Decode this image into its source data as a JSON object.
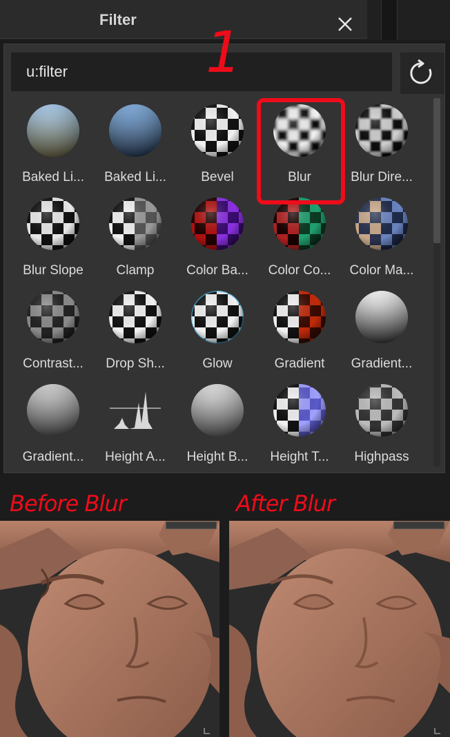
{
  "window": {
    "title": "Filter"
  },
  "search": {
    "value": "u:filter"
  },
  "annotation": {
    "step_number": "1",
    "before_caption": "Before Blur",
    "after_caption": "After Blur"
  },
  "filters": [
    {
      "label": "Baked Li...",
      "thumb": "sky-sphere-icon"
    },
    {
      "label": "Baked Li...",
      "thumb": "sky-blue-sphere-icon"
    },
    {
      "label": "Bevel",
      "thumb": "checker-sphere-icon"
    },
    {
      "label": "Blur",
      "thumb": "blurred-checker-sphere-icon"
    },
    {
      "label": "Blur Dire...",
      "thumb": "directional-blur-sphere-icon"
    },
    {
      "label": "Blur Slope",
      "thumb": "slope-sphere-icon"
    },
    {
      "label": "Clamp",
      "thumb": "clamp-sphere-icon"
    },
    {
      "label": "Color Ba...",
      "thumb": "color-balance-sphere-icon"
    },
    {
      "label": "Color Co...",
      "thumb": "color-correct-sphere-icon"
    },
    {
      "label": "Color Ma...",
      "thumb": "color-match-sphere-icon"
    },
    {
      "label": "Contrast...",
      "thumb": "contrast-sphere-icon"
    },
    {
      "label": "Drop Sh...",
      "thumb": "drop-shadow-sphere-icon"
    },
    {
      "label": "Glow",
      "thumb": "glow-sphere-icon"
    },
    {
      "label": "Gradient",
      "thumb": "gradient-sphere-icon"
    },
    {
      "label": "Gradient...",
      "thumb": "gradient-bw-sphere-icon"
    },
    {
      "label": "Gradient...",
      "thumb": "gradient-stripes-sphere-icon"
    },
    {
      "label": "Height A...",
      "thumb": "height-graph-icon"
    },
    {
      "label": "Height B...",
      "thumb": "height-blend-sphere-icon"
    },
    {
      "label": "Height T...",
      "thumb": "height-normal-sphere-icon"
    },
    {
      "label": "Highpass",
      "thumb": "highpass-sphere-icon"
    }
  ],
  "colors": {
    "accent_red": "#ee0c1a",
    "panel": "#333333",
    "skin": "#a8745e"
  }
}
